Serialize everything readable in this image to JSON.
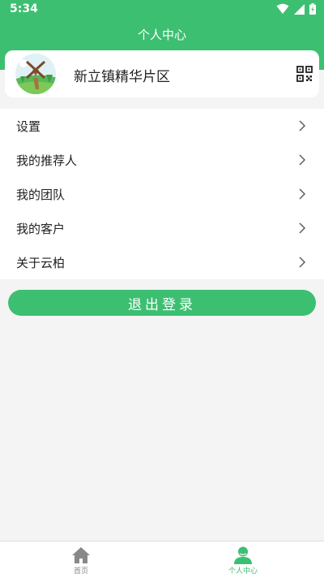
{
  "status_bar": {
    "time": "5:34"
  },
  "header": {
    "title": "个人中心"
  },
  "profile": {
    "name": "新立镇精华片区"
  },
  "menu": {
    "items": [
      {
        "label": "设置"
      },
      {
        "label": "我的推荐人"
      },
      {
        "label": "我的团队"
      },
      {
        "label": "我的客户"
      },
      {
        "label": "关于云柏"
      }
    ]
  },
  "logout": {
    "label": "退出登录"
  },
  "bottom_nav": {
    "items": [
      {
        "label": "首页",
        "icon": "home-icon",
        "active": false
      },
      {
        "label": "个人中心",
        "icon": "user-icon",
        "active": true
      }
    ]
  },
  "colors": {
    "brand_green": "#3dbf72",
    "inactive_gray": "#888888",
    "text_dark": "#222222"
  }
}
